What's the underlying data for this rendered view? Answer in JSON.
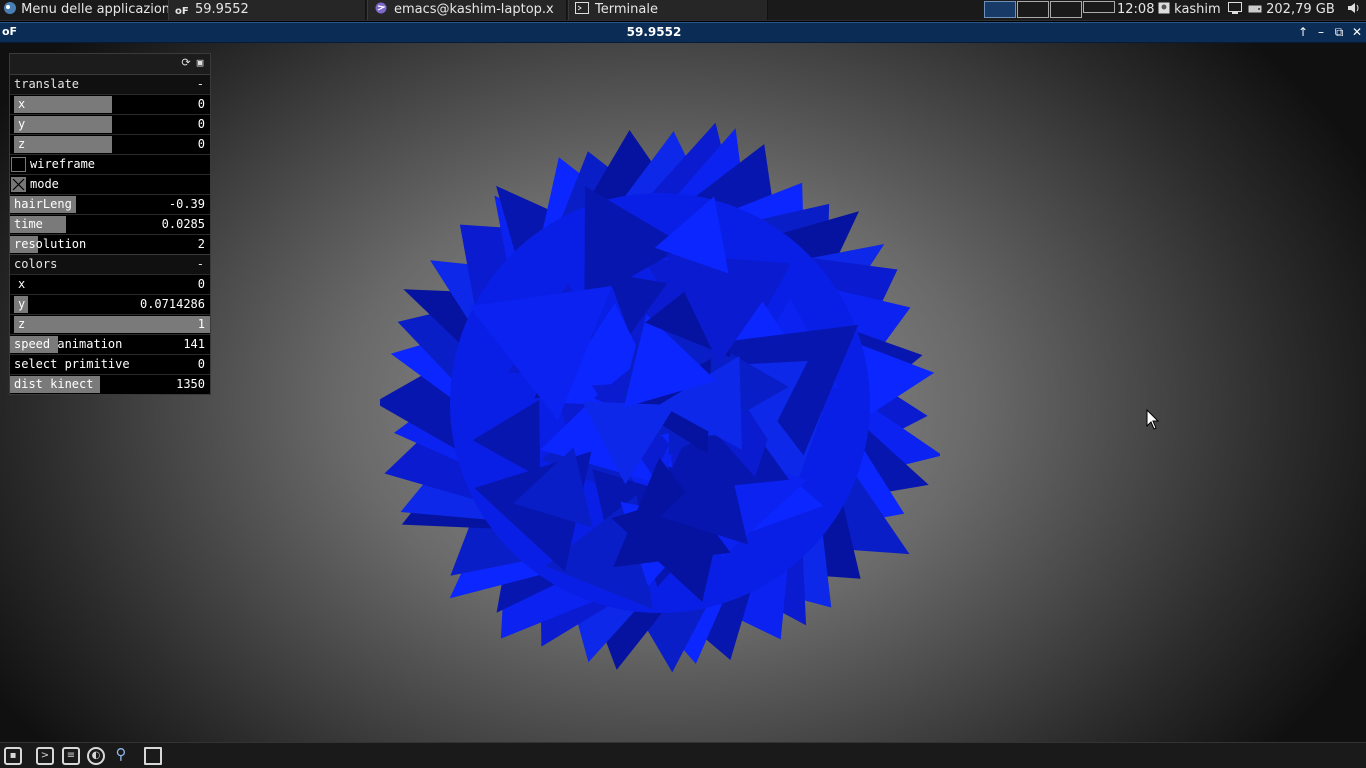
{
  "top_panel": {
    "app_menu_label": "Menu delle applicazioni",
    "tasks": [
      {
        "label": "59.9552",
        "icon": "openframeworks-icon"
      },
      {
        "label": "emacs@kashim-laptop.x",
        "icon": "emacs-icon"
      },
      {
        "label": "Terminale",
        "icon": "terminal-icon"
      }
    ],
    "workspaces": 4,
    "active_workspace": 1,
    "clock": "12:08",
    "user": "kashim",
    "disk_free": "202,79 GB"
  },
  "window": {
    "logo": "oF",
    "title": "59.9552",
    "buttons": [
      "↑",
      "–",
      "⧉",
      "✕"
    ]
  },
  "gui": {
    "groups": [
      {
        "name": "translate",
        "collapse": "-",
        "params": [
          {
            "label": "x",
            "value": "0",
            "fill": 0.5
          },
          {
            "label": "y",
            "value": "0",
            "fill": 0.5
          },
          {
            "label": "z",
            "value": "0",
            "fill": 0.5
          }
        ]
      },
      {
        "name": "colors",
        "collapse": "-",
        "params": [
          {
            "label": "x",
            "value": "0",
            "fill": 0.0
          },
          {
            "label": "y",
            "value": "0.0714286",
            "fill": 0.07
          },
          {
            "label": "z",
            "value": "1",
            "fill": 1.0
          }
        ]
      }
    ],
    "toggles": [
      {
        "label": "wireframe",
        "checked": false
      },
      {
        "label": "mode",
        "checked": true
      }
    ],
    "sliders": [
      {
        "label": "hairLeng",
        "value": "-0.39",
        "fill": 0.33
      },
      {
        "label": "time",
        "value": "0.0285",
        "fill": 0.28
      },
      {
        "label": "resolution",
        "value": "2",
        "fill": 0.14
      }
    ],
    "sliders2": [
      {
        "label": "speed animation",
        "value": "141",
        "fill": 0.24
      },
      {
        "label": "select primitive",
        "value": "0",
        "fill": 0.0
      },
      {
        "label": "dist kinect",
        "value": "1350",
        "fill": 0.45
      }
    ]
  },
  "scene": {
    "object": "spiky-sphere",
    "color": "#0a1fe6"
  },
  "bottom_panel": {
    "launchers": [
      "show-desktop-icon",
      "terminal-icon",
      "file-manager-icon",
      "web-browser-icon",
      "search-icon",
      "folder-icon"
    ]
  }
}
